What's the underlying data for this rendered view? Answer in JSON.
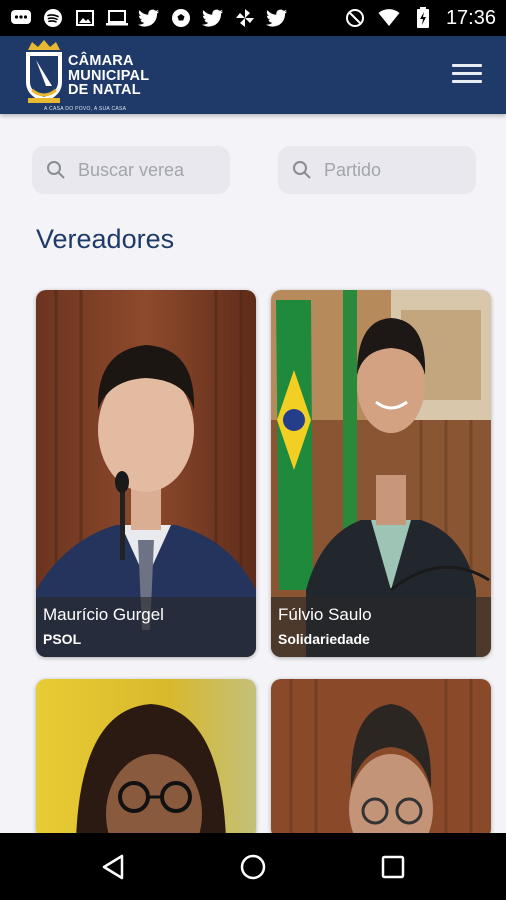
{
  "status_bar": {
    "time": "17:36",
    "icons": [
      "messaging-icon",
      "spotify-icon",
      "image-icon",
      "laptop-icon",
      "twitter-icon",
      "soccer-icon",
      "twitter-icon",
      "pinwheel-icon",
      "twitter-icon",
      "dnd-icon",
      "wifi-icon",
      "battery-charging-icon"
    ]
  },
  "header": {
    "logo_line1": "CÂMARA",
    "logo_line2": "MUNICIPAL",
    "logo_line3": "DE NATAL",
    "tagline": "A CASA DO POVO, A SUA CASA",
    "menu_icon": "hamburger-menu-icon"
  },
  "search": {
    "vereador_placeholder": "Buscar verea",
    "partido_placeholder": "Partido"
  },
  "section": {
    "title": "Vereadores"
  },
  "vereadores": [
    {
      "name": "Maurício Gurgel",
      "party": "PSOL"
    },
    {
      "name": "Fúlvio Saulo",
      "party": "Solidariedade"
    },
    {
      "name": "",
      "party": ""
    },
    {
      "name": "",
      "party": ""
    }
  ],
  "colors": {
    "primary": "#1f3a68",
    "background": "#f4f4f8",
    "field_bg": "#e8e8ee"
  }
}
